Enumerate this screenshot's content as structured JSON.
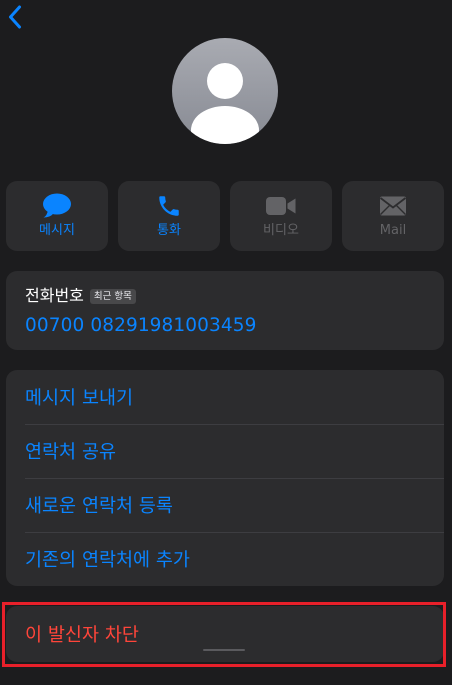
{
  "nav": {
    "back_icon": "chevron-left-icon"
  },
  "contact": {
    "avatar_icon": "person-silhouette-icon"
  },
  "actions": [
    {
      "label": "메시지",
      "icon": "message-bubble-icon",
      "enabled": true
    },
    {
      "label": "통화",
      "icon": "phone-icon",
      "enabled": true
    },
    {
      "label": "비디오",
      "icon": "video-camera-icon",
      "enabled": false
    },
    {
      "label": "Mail",
      "icon": "envelope-icon",
      "enabled": false
    }
  ],
  "phone": {
    "label": "전화번호",
    "badge": "최근 항목",
    "number": "00700 08291981003459"
  },
  "options": [
    {
      "label": "메시지 보내기"
    },
    {
      "label": "연락처 공유"
    },
    {
      "label": "새로운 연락처 등록"
    },
    {
      "label": "기존의 연락처에 추가"
    }
  ],
  "block": {
    "label": "이 발신자 차단"
  },
  "colors": {
    "background": "#1c1c1e",
    "card": "#2c2c2e",
    "accent": "#0a84ff",
    "disabled": "#636366",
    "destructive": "#ff453a",
    "highlight": "#e8202a"
  }
}
